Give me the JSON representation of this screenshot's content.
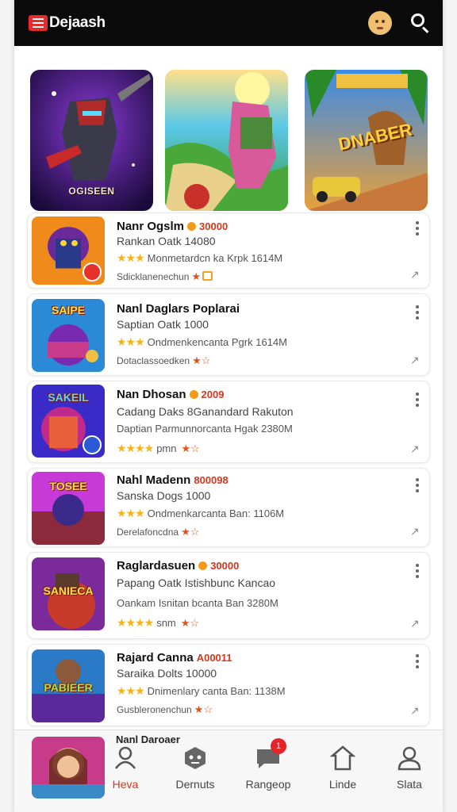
{
  "header": {
    "brand": "Dejaash",
    "icons": [
      "menu-icon",
      "face-icon",
      "search-icon"
    ]
  },
  "banners": [
    {
      "caption": "OGISEEN",
      "icon": "warrior-art"
    },
    {
      "caption": "",
      "icon": "tropical-art"
    },
    {
      "caption": "DNABER",
      "icon": "dino-art"
    }
  ],
  "apps": [
    {
      "title": "Nanr Ogslm",
      "price": "30000",
      "subtitle": "Rankan Oatk 14080",
      "stars": "★★★",
      "meta": "Monmetardcn ka Krpk 1614M",
      "footer": "Sdicklanenechun",
      "thumb_word": "",
      "colors": [
        "#f08a1a",
        "#6a2a9a"
      ]
    },
    {
      "title": "Nanl Daglars Poplarai",
      "price": "",
      "subtitle": "Saptian Oatk 1000",
      "stars": "★★★",
      "meta": "Ondmenkencanta Pgrk 1614M",
      "footer": "Dotaclassoedken",
      "thumb_word": "SAIPE",
      "colors": [
        "#2a8ad8",
        "#7a2ab0"
      ]
    },
    {
      "title": "Nan Dhosan",
      "price": "2009",
      "subtitle": "Cadang Daks 8Ganandard Rakuton",
      "stars": "★★★★",
      "meta": "pmn",
      "meta_prefix": "Daptian Parmunnorcanta Hgak 2380M",
      "footer": "",
      "thumb_word": "SAKEIL",
      "colors": [
        "#3a2ac8",
        "#c02a8a"
      ]
    },
    {
      "title": "Nahl Madenn",
      "price": "800098",
      "subtitle": "Sanska Dogs 1000",
      "stars": "★★★",
      "meta": "Ondmenkarcanta Ban: 1106M",
      "footer": "Derelafoncdna",
      "thumb_word": "TOSEE",
      "colors": [
        "#c83ad8",
        "#8a2a3a"
      ]
    },
    {
      "title": "Raglardasuen",
      "price": "30000",
      "subtitle": "Papang Oatk Istishbunc Kancao",
      "stars": "★★★★",
      "meta": "snm",
      "meta_prefix": "Oankam Isnitan bcanta Ban 3280M",
      "footer": "",
      "thumb_word": "SANIECA",
      "colors": [
        "#7a2a9a",
        "#c83a2a"
      ]
    },
    {
      "title": "Rajard Canna",
      "price": "A00011",
      "subtitle": "Saraika Dolts 10000",
      "stars": "★★★",
      "meta": "Dnimenlary canta Ban: 1138M",
      "footer": "Gusbleronenchun",
      "thumb_word": "PABIEER",
      "colors": [
        "#2a7ac8",
        "#5a2a9a"
      ]
    }
  ],
  "peek_title": "Nanl Daroaer",
  "nav": [
    {
      "label": "Heva",
      "icon": "people-icon",
      "active": true
    },
    {
      "label": "Dernuts",
      "icon": "chat-face-icon",
      "active": false
    },
    {
      "label": "Rangeop",
      "icon": "message-icon",
      "active": false,
      "badge": "1"
    },
    {
      "label": "Linde",
      "icon": "home-icon",
      "active": false
    },
    {
      "label": "Slata",
      "icon": "profile-icon",
      "active": false
    }
  ],
  "colors": {
    "accent": "#d9361b",
    "header_bg": "#0b0b0b",
    "star": "#f2b31b"
  }
}
